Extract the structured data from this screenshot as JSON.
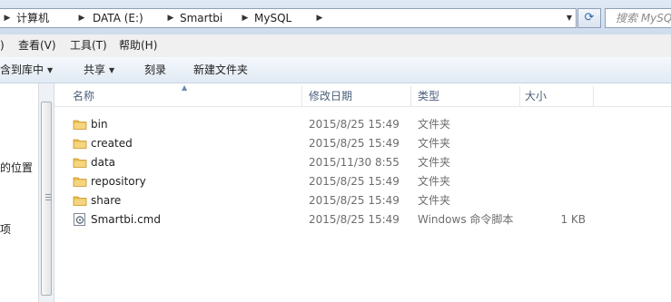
{
  "address": {
    "segments": [
      "计算机",
      "DATA (E:)",
      "Smartbi",
      "MySQL"
    ],
    "search_placeholder": "搜索 MySQL"
  },
  "menu": {
    "items": [
      ")",
      "查看(V)",
      "工具(T)",
      "帮助(H)"
    ]
  },
  "commands": {
    "include_library": "含到库中",
    "share": "共享",
    "burn": "刻录",
    "new_folder": "新建文件夹"
  },
  "nav": {
    "items": [
      "的位置",
      "项"
    ]
  },
  "columns": {
    "name": "名称",
    "date": "修改日期",
    "type": "类型",
    "size": "大小"
  },
  "files": [
    {
      "name": "bin",
      "date": "2015/8/25 15:49",
      "type": "文件夹",
      "size": "",
      "icon": "folder-icon"
    },
    {
      "name": "created",
      "date": "2015/8/25 15:49",
      "type": "文件夹",
      "size": "",
      "icon": "folder-icon"
    },
    {
      "name": "data",
      "date": "2015/11/30 8:55",
      "type": "文件夹",
      "size": "",
      "icon": "folder-icon"
    },
    {
      "name": "repository",
      "date": "2015/8/25 15:49",
      "type": "文件夹",
      "size": "",
      "icon": "folder-icon"
    },
    {
      "name": "share",
      "date": "2015/8/25 15:49",
      "type": "文件夹",
      "size": "",
      "icon": "folder-icon"
    },
    {
      "name": "Smartbi.cmd",
      "date": "2015/8/25 15:49",
      "type": "Windows 命令脚本",
      "size": "1 KB",
      "icon": "cmd-file-icon"
    }
  ],
  "colors": {
    "folder": "#e8b94a",
    "header_text": "#4c607a",
    "meta_text": "#6d6d6d"
  }
}
